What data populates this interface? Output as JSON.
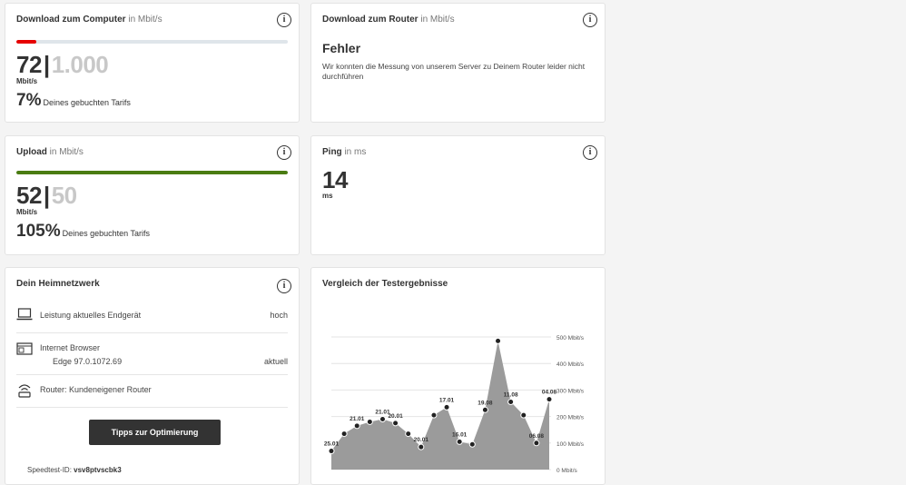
{
  "download": {
    "title": "Download zum Computer",
    "unit": "in Mbit/s",
    "value": "72",
    "separator": "|",
    "tariff": "1.000",
    "value_unit": "Mbit/s",
    "percent": "7%",
    "percent_text": "Deines gebuchten Tarifs",
    "bar_fraction": 0.072,
    "bar_color": "#e60000"
  },
  "download_router": {
    "title": "Download zum Router",
    "unit": "in Mbit/s",
    "error_title": "Fehler",
    "error_message": "Wir konnten die Messung von unserem Server zu Deinem Router leider nicht durchführen"
  },
  "upload": {
    "title": "Upload",
    "unit": "in Mbit/s",
    "value": "52",
    "separator": "|",
    "tariff": "50",
    "value_unit": "Mbit/s",
    "percent": "105%",
    "percent_text": "Deines gebuchten Tarifs",
    "bar_fraction": 1.0,
    "bar_color": "#4a7c12"
  },
  "ping": {
    "title": "Ping",
    "unit": "in ms",
    "value": "14",
    "value_unit": "ms"
  },
  "network": {
    "title": "Dein Heimnetzwerk",
    "rows": [
      {
        "icon": "laptop-icon",
        "label": "Leistung aktuelles Endgerät",
        "value": "hoch"
      },
      {
        "icon": "browser-icon",
        "label": "Internet Browser",
        "sublabel": "Edge 97.0.1072.69",
        "value": "aktuell"
      },
      {
        "icon": "router-icon",
        "label": "Router: Kundeneigener Router",
        "value": ""
      }
    ],
    "button_label": "Tipps zur Optimierung",
    "speedtest_label": "Speedtest-ID:",
    "speedtest_id": "vsv8ptvscbk3"
  },
  "comparison": {
    "title": "Vergleich der Testergebnisse"
  },
  "chart_data": {
    "type": "area",
    "title": "Vergleich der Testergebnisse",
    "y_unit": "Mbit/s",
    "ylim": [
      0,
      500
    ],
    "yticks": [
      "0 Mbit/s",
      "100 Mbit/s",
      "200 Mbit/s",
      "300 Mbit/s",
      "400 Mbit/s",
      "500 Mbit/s"
    ],
    "ytick_values": [
      0,
      100,
      200,
      300,
      400,
      500
    ],
    "grid": true,
    "fill_color": "#9b9b9b",
    "point_labels": [
      "25.01",
      "",
      "21.01",
      "",
      "21.01",
      "20.01",
      "",
      "20.01",
      "",
      "17.01",
      "16.01",
      "",
      "19.08",
      "",
      "11.08",
      "",
      "06.08",
      "04.08",
      ""
    ],
    "values": [
      70,
      135,
      165,
      180,
      190,
      175,
      135,
      85,
      205,
      235,
      105,
      95,
      225,
      485,
      255,
      205,
      100,
      265
    ]
  }
}
